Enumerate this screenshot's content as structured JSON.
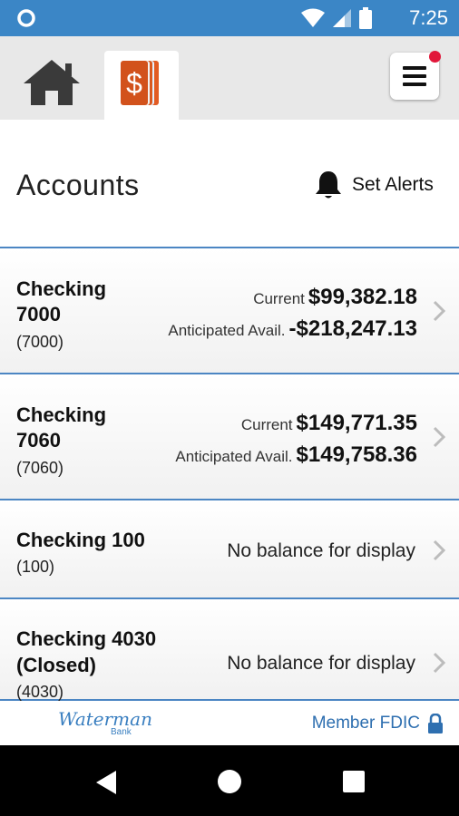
{
  "status_bar": {
    "time": "7:25"
  },
  "header": {
    "title": "Accounts",
    "set_alerts_label": "Set Alerts"
  },
  "accounts": [
    {
      "name_line1": "Checking",
      "name_line2": "7000",
      "number": "(7000)",
      "current_label": "Current",
      "current_value": "$99,382.18",
      "anticipated_label": "Anticipated Avail.",
      "anticipated_value": "-$218,247.13"
    },
    {
      "name_line1": "Checking",
      "name_line2": "7060",
      "number": "(7060)",
      "current_label": "Current",
      "current_value": "$149,771.35",
      "anticipated_label": "Anticipated Avail.",
      "anticipated_value": "$149,758.36"
    },
    {
      "name_line1": "Checking 100",
      "number": "(100)",
      "balance_text": "No balance for display"
    },
    {
      "name_line1": "Checking 4030",
      "name_line2": "(Closed)",
      "number": "(4030)",
      "balance_text": "No balance for display"
    }
  ],
  "footer": {
    "logo_text": "Waterman",
    "logo_subtext": "Bank",
    "fdic_text": "Member FDIC"
  },
  "icons": {
    "home": "home-icon",
    "accounts": "dollar-cards-icon",
    "menu": "hamburger-icon",
    "bell": "bell-icon",
    "chevron": "chevron-right-icon",
    "lock": "lock-icon",
    "back": "back-triangle-icon",
    "nav_home": "circle-home-icon",
    "recents": "square-recents-icon"
  },
  "colors": {
    "status_bar": "#3b86c6",
    "accent_orange": "#d9581f",
    "divider_blue": "#4c86c3",
    "badge_red": "#e1173a"
  }
}
